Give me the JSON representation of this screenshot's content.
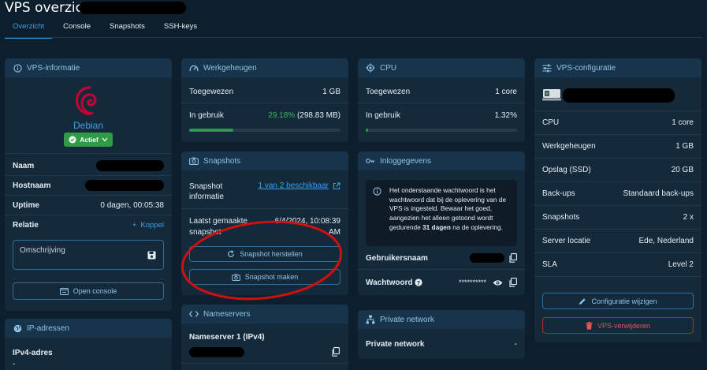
{
  "header": {
    "title": "VPS overzicht"
  },
  "tabs": [
    {
      "label": "Overzicht"
    },
    {
      "label": "Console"
    },
    {
      "label": "Snapshots"
    },
    {
      "label": "SSH-keys"
    }
  ],
  "vps_info": {
    "title": "VPS-informatie",
    "os_name": "Debian",
    "status": "Actief",
    "rows": [
      {
        "label": "Naam",
        "value": ""
      },
      {
        "label": "Hostnaam",
        "value": ""
      },
      {
        "label": "Uptime",
        "value": "0 dagen, 00:05:38"
      },
      {
        "label": "Relatie",
        "value": "Koppel"
      }
    ],
    "description_placeholder": "Omschrijving",
    "open_console": "Open console"
  },
  "ip": {
    "title": "IP-adressen",
    "ipv4_label": "IPv4-adres",
    "ipv4_value": "-"
  },
  "memory": {
    "title": "Werkgeheugen",
    "assigned_label": "Toegewezen",
    "assigned_value": "1 GB",
    "used_label": "In gebruik",
    "used_pct": "29.18%",
    "used_mb": "(298.83 MB)",
    "used_fraction": 0.2918
  },
  "cpu": {
    "title": "CPU",
    "assigned_label": "Toegewezen",
    "assigned_value": "1 core",
    "used_label": "In gebruik",
    "used_pct": "1.32%",
    "used_fraction": 0.0132
  },
  "snapshots": {
    "title": "Snapshots",
    "info_label": "Snapshot informatie",
    "info_value": "1 van 2 beschikbaar",
    "last_label": "Laatst gemaakte snapshot",
    "last_value": "6/4/2024, 10:08:39 AM",
    "restore_button": "Snapshot herstellen",
    "make_button": "Snapshot maken"
  },
  "login": {
    "title": "Inloggegevens",
    "notice_pre": "Het onderstaande wachtwoord is het wachtwoord dat bij de oplevering van de VPS is ingesteld. Bewaar het goed, aangezien het alleen getoond wordt gedurende ",
    "notice_bold": "31 dagen",
    "notice_post": " na de oplevering.",
    "username_label": "Gebruikersnaam",
    "password_label": "Wachtwoord",
    "password_value": "**********"
  },
  "nameservers": {
    "title": "Nameservers",
    "ns1_label": "Nameserver 1 (IPv4)"
  },
  "private_network": {
    "title": "Private network",
    "label": "Private network",
    "value": "-"
  },
  "config": {
    "title": "VPS-configuratie",
    "rows": [
      {
        "label": "CPU",
        "value": "1 core"
      },
      {
        "label": "Werkgeheugen",
        "value": "1 GB"
      },
      {
        "label": "Opslag (SSD)",
        "value": "20 GB"
      },
      {
        "label": "Back-ups",
        "value": "Standaard back-ups"
      },
      {
        "label": "Snapshots",
        "value": "2 x"
      },
      {
        "label": "Server locatie",
        "value": "Ede, Nederland"
      },
      {
        "label": "SLA",
        "value": "Level 2"
      }
    ],
    "edit_button": "Configuratie wijzigen",
    "delete_button": "VPS-verwijderen"
  },
  "colors": {
    "accent": "#3aa0e3",
    "success": "#2e9b45",
    "danger": "#b02a2a",
    "annotation": "#d01010"
  }
}
